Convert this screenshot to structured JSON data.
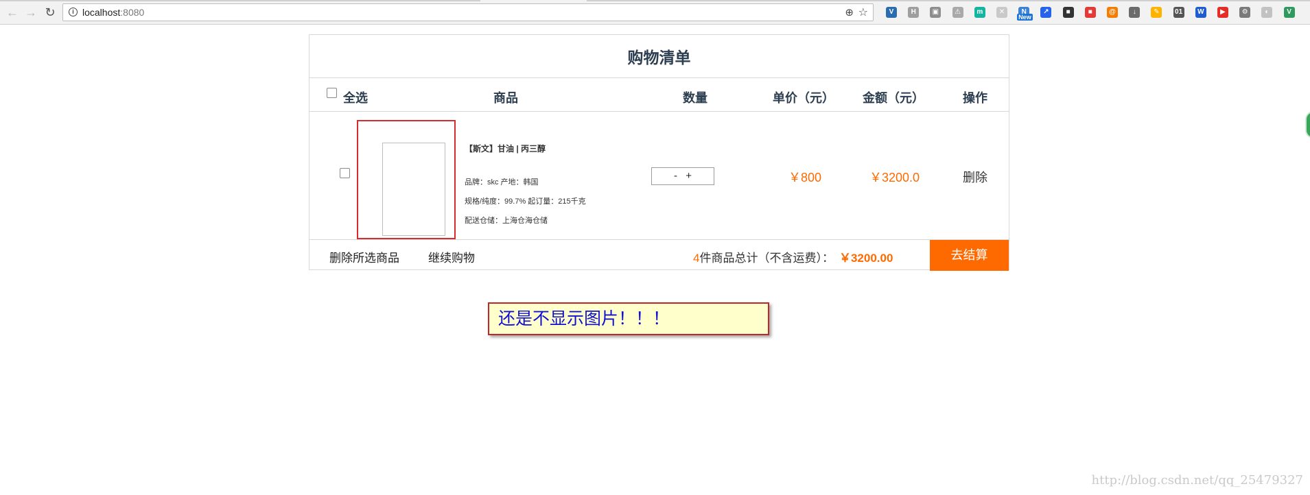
{
  "browser": {
    "url_host": "localhost",
    "url_port": ":8080",
    "icons": {
      "back": "back-arrow-icon",
      "forward": "forward-arrow-icon",
      "reload": "reload-icon",
      "info": "info-icon",
      "zoom": "zoom-icon",
      "bookmark": "star-icon"
    },
    "extensions": [
      {
        "name": "v-extension-icon",
        "glyph": "V",
        "color": "#2b6cb0"
      },
      {
        "name": "h-extension-icon",
        "glyph": "H",
        "color": "#9e9e9e"
      },
      {
        "name": "square-extension-icon",
        "glyph": "▣",
        "color": "#8d8d8d"
      },
      {
        "name": "triangle-extension-icon",
        "glyph": "⚠",
        "color": "#a9a9a9"
      },
      {
        "name": "m-extension-icon",
        "glyph": "m",
        "color": "#13b5a0"
      },
      {
        "name": "red-extension-icon",
        "glyph": "✕",
        "color": "#c9c9c9"
      },
      {
        "name": "new-extension-icon",
        "glyph": "N",
        "color": "#3b82d6",
        "badge": "New"
      },
      {
        "name": "blue-extension-icon",
        "glyph": "↗",
        "color": "#2563eb"
      },
      {
        "name": "dark-extension-icon",
        "glyph": "■",
        "color": "#333333"
      },
      {
        "name": "red-square-extension-icon",
        "glyph": "■",
        "color": "#e53935"
      },
      {
        "name": "orange-extension-icon",
        "glyph": "@",
        "color": "#f57c00"
      },
      {
        "name": "page-extension-icon",
        "glyph": "↓",
        "color": "#6b6b6b"
      },
      {
        "name": "rainbow-extension-icon",
        "glyph": "✎",
        "color": "#ffb300"
      },
      {
        "name": "01-extension-icon",
        "glyph": "01",
        "color": "#555555"
      },
      {
        "name": "w-extension-icon",
        "glyph": "W",
        "color": "#1e5ccf"
      },
      {
        "name": "youtube-extension-icon",
        "glyph": "▶",
        "color": "#e52d27"
      },
      {
        "name": "gear-extension-icon",
        "glyph": "⚙",
        "color": "#7a7a7a"
      },
      {
        "name": "grey-extension-icon",
        "glyph": "◐",
        "color": "#c2c2c2"
      },
      {
        "name": "vue-extension-icon",
        "glyph": "V",
        "color": "#2e9a5e"
      }
    ],
    "extension_badge": "New"
  },
  "cart": {
    "title": "购物清单",
    "headers": {
      "select_all": "全选",
      "product": "商品",
      "quantity": "数量",
      "unit_price": "单价（元）",
      "amount": "金额（元）",
      "action": "操作"
    },
    "item": {
      "name": "【斯文】甘油 | 丙三醇",
      "brand_line": "品牌：skc  产地：韩国",
      "spec_line": "规格/纯度：99.7%  起订量：215千克",
      "warehouse_line": "配送仓储：上海仓海仓储",
      "qty_minus": "-",
      "qty_plus": "+",
      "unit_price": "￥800",
      "amount": "￥3200.0",
      "delete": "删除"
    },
    "footer": {
      "delete_selected": "删除所选商品",
      "continue_shopping": "继续购物",
      "count": "4",
      "total_label": "件商品总计（不含运费）：",
      "total_value": "￥3200.00",
      "checkout": "去结算"
    }
  },
  "annotation": {
    "text": "还是不显示图片！！！"
  },
  "watermark": "http://blog.csdn.net/qq_25479327"
}
